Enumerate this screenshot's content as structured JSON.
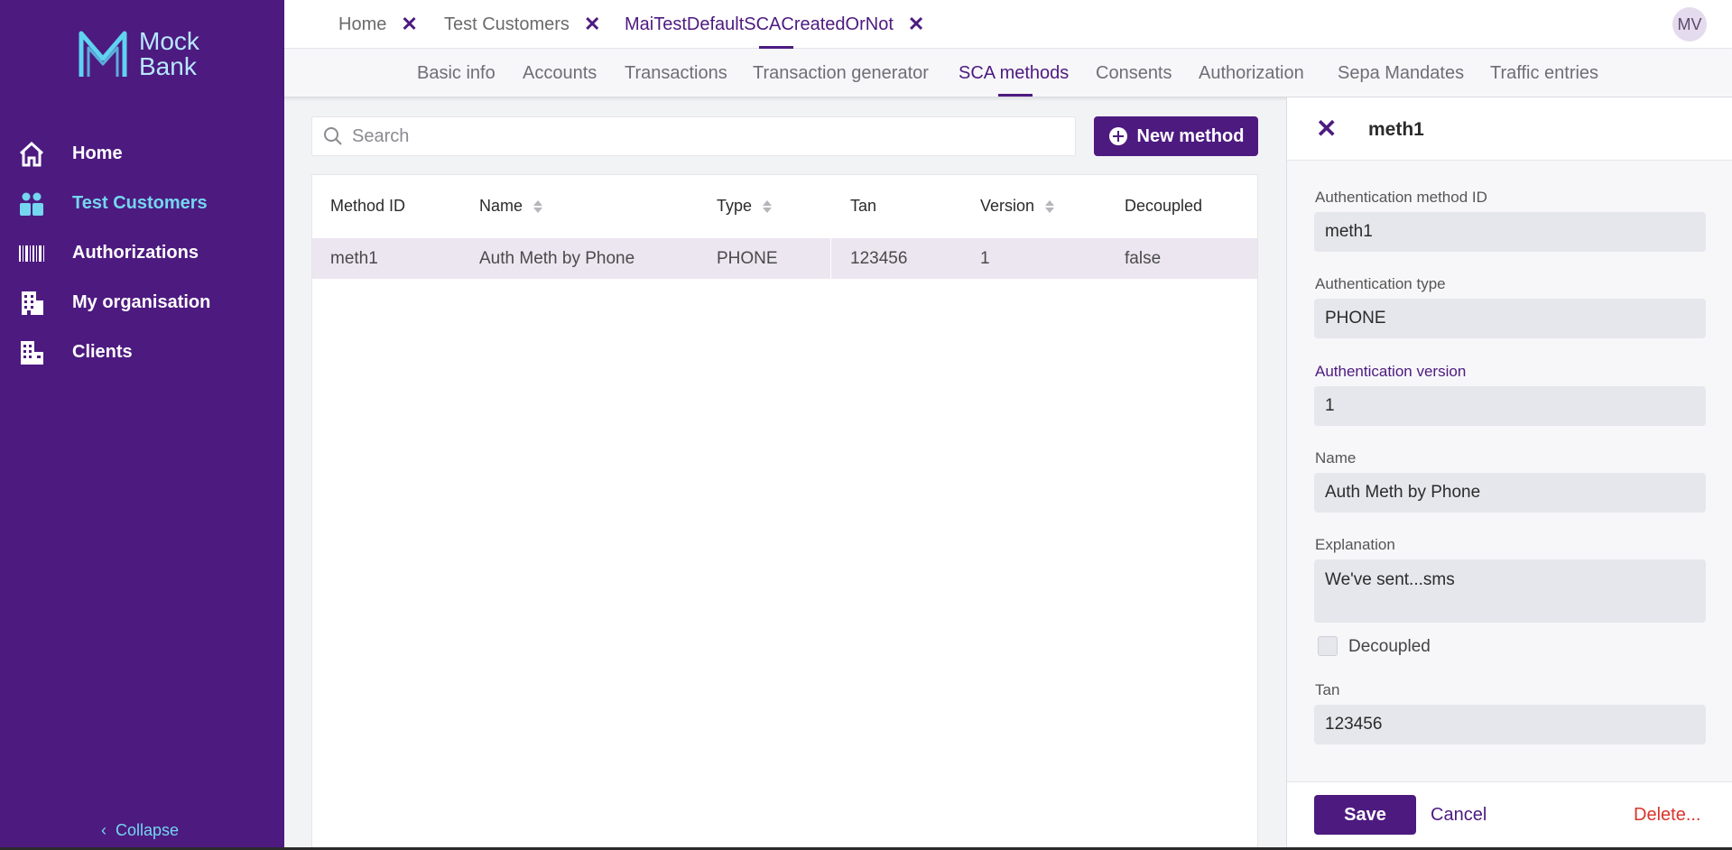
{
  "app": {
    "logo_line1": "Mock",
    "logo_line2": "Bank"
  },
  "sidebar": {
    "items": [
      {
        "label": "Home",
        "icon": "home-icon"
      },
      {
        "label": "Test Customers",
        "icon": "people-icon",
        "active": true
      },
      {
        "label": "Authorizations",
        "icon": "barcode-icon"
      },
      {
        "label": "My organisation",
        "icon": "building-icon"
      },
      {
        "label": "Clients",
        "icon": "office-icon"
      }
    ],
    "collapse_label": "Collapse"
  },
  "doc_tabs": [
    {
      "label": "Home"
    },
    {
      "label": "Test Customers"
    },
    {
      "label": "MaiTestDefaultSCACreatedOrNot",
      "active": true
    }
  ],
  "avatar_initials": "MV",
  "subnav": [
    "Basic info",
    "Accounts",
    "Transactions",
    "Transaction generator",
    "SCA methods",
    "Consents",
    "Authorization",
    "Sepa Mandates",
    "Traffic entries"
  ],
  "subnav_active": "SCA methods",
  "search": {
    "placeholder": "Search",
    "value": ""
  },
  "new_method_label": "New method",
  "table": {
    "columns": [
      "Method ID",
      "Name",
      "Type",
      "Tan",
      "Version",
      "Decoupled"
    ],
    "rows": [
      [
        "meth1",
        "Auth Meth by Phone",
        "PHONE",
        "123456",
        "1",
        "false"
      ]
    ]
  },
  "detail": {
    "title": "meth1",
    "fields": {
      "method_id_label": "Authentication method ID",
      "method_id_value": "meth1",
      "type_label": "Authentication type",
      "type_value": "PHONE",
      "version_label": "Authentication version",
      "version_value": "1",
      "name_label": "Name",
      "name_value": "Auth Meth by Phone",
      "explanation_label": "Explanation",
      "explanation_value": "We've sent...sms",
      "decoupled_label": "Decoupled",
      "decoupled_checked": false,
      "tan_label": "Tan",
      "tan_value": "123456"
    },
    "save_label": "Save",
    "cancel_label": "Cancel",
    "delete_label": "Delete..."
  },
  "colors": {
    "brand": "#4d1a80",
    "accent": "#74d6ef",
    "danger": "#d9352b"
  }
}
